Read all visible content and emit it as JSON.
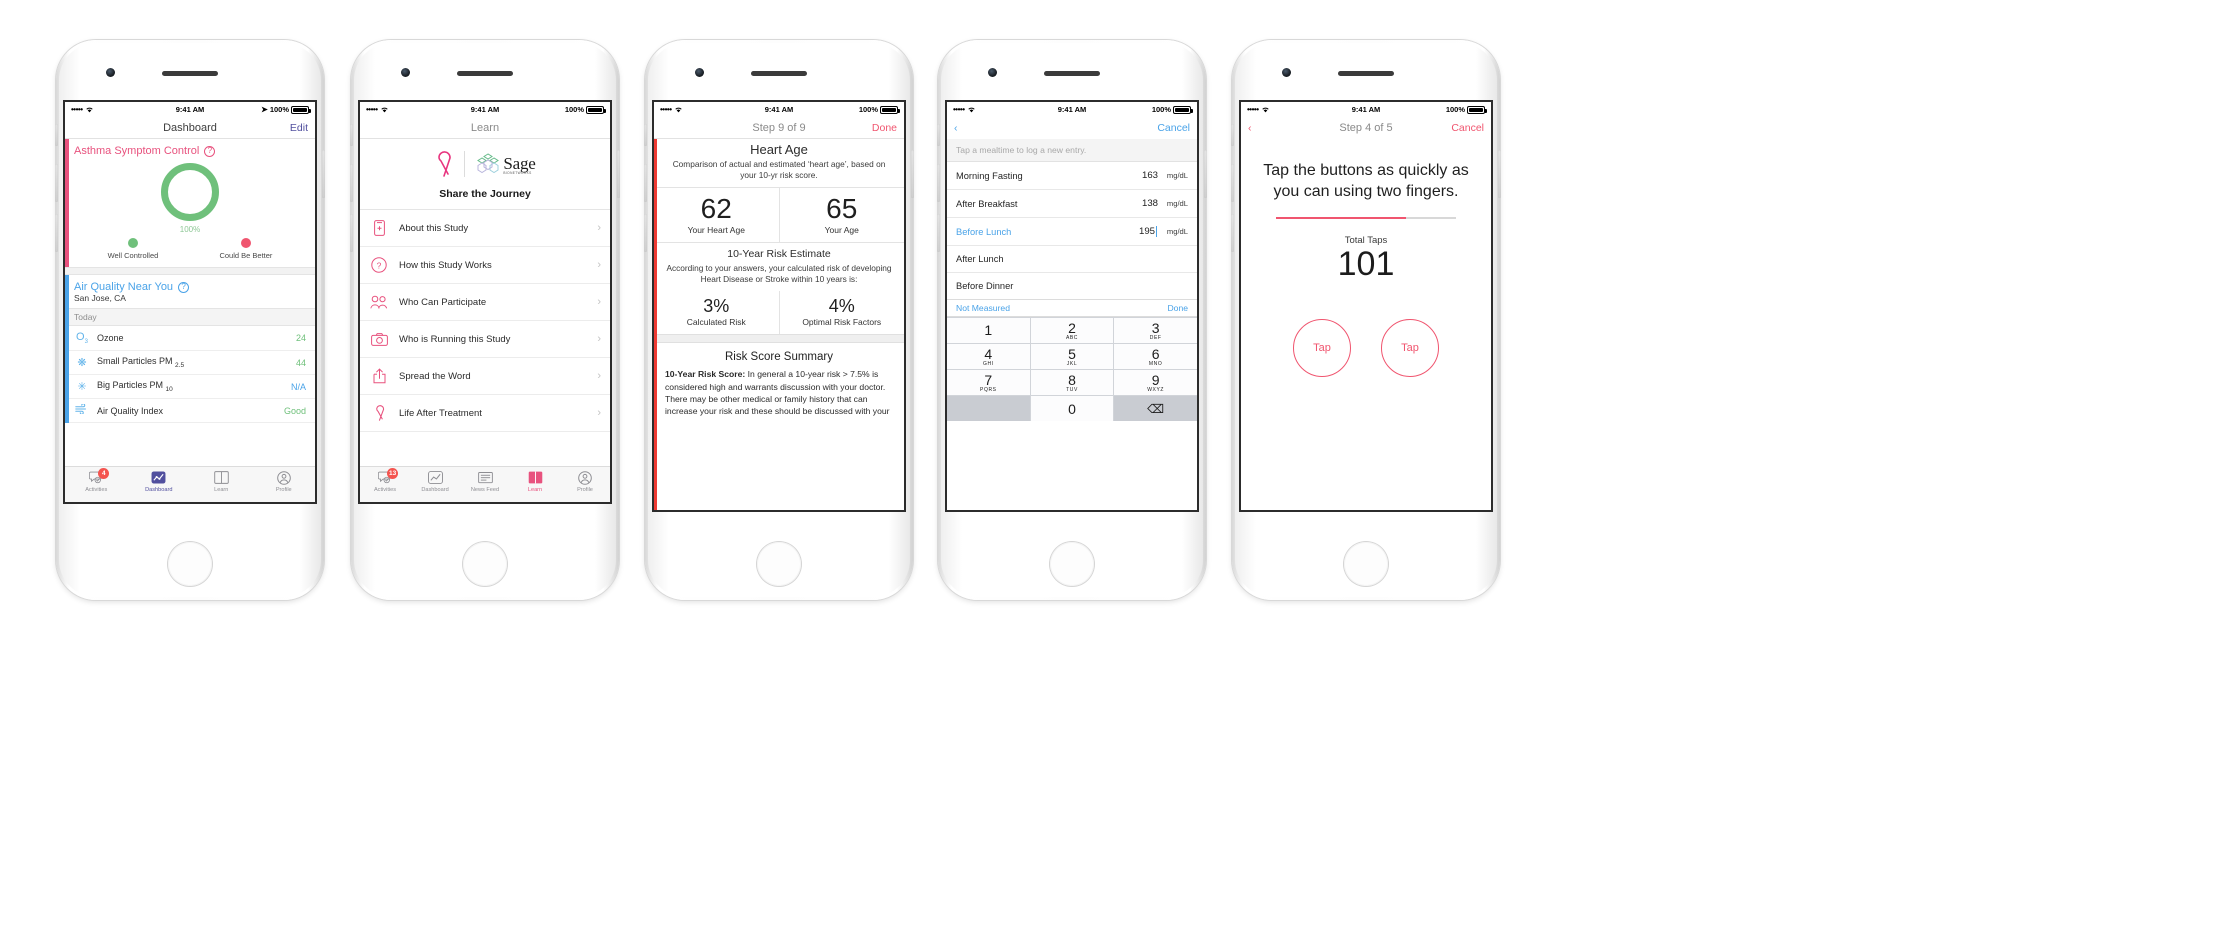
{
  "status_bar": {
    "signal": "•••••",
    "wifi": "wifi-icon",
    "time": "9:41 AM",
    "battery_pct": "100%"
  },
  "phone1": {
    "nav": {
      "title": "Dashboard",
      "right": "Edit"
    },
    "status_location_icon": "location-arrow-icon",
    "asthma": {
      "title": "Asthma Symptom Control",
      "help": "?",
      "ring_pct": "100%",
      "accent": "#e8527e",
      "ring_color": "#6fc07b",
      "legend": [
        {
          "label": "Well Controlled",
          "color": "#6fc07b"
        },
        {
          "label": "Could Be Better",
          "color": "#f0556f"
        }
      ]
    },
    "air": {
      "title": "Air Quality Near You",
      "help": "?",
      "location": "San Jose, CA",
      "section": "Today",
      "accent": "#4aa3e8",
      "rows": [
        {
          "icon": "ozone-icon",
          "name": "Ozone",
          "sub": "3",
          "value": "24",
          "value_color": "#6fc07b"
        },
        {
          "icon": "small-particles-icon",
          "name": "Small Particles PM",
          "sub": "2.5",
          "value": "44",
          "value_color": "#6fc07b"
        },
        {
          "icon": "big-particles-icon",
          "name": "Big Particles PM",
          "sub": "10",
          "value": "N/A",
          "value_color": "#4aa3e8"
        },
        {
          "icon": "wind-icon",
          "name": "Air Quality Index",
          "sub": "",
          "value": "Good",
          "value_color": "#6fc07b"
        }
      ]
    },
    "tabs": [
      {
        "label": "Activities",
        "icon": "chat-check-icon",
        "badge": "4",
        "active": false
      },
      {
        "label": "Dashboard",
        "icon": "line-chart-icon",
        "badge": "",
        "active": true
      },
      {
        "label": "Learn",
        "icon": "book-icon",
        "badge": "",
        "active": false
      },
      {
        "label": "Profile",
        "icon": "person-icon",
        "badge": "",
        "active": false
      }
    ]
  },
  "phone2": {
    "nav": {
      "title": "Learn"
    },
    "brand": {
      "ribbon_icon": "ribbon-icon",
      "logo_name": "Sage",
      "logo_sub": "BIONETWORKS",
      "headline": "Share the Journey"
    },
    "rows": [
      {
        "icon": "phone-plus-icon",
        "label": "About this Study"
      },
      {
        "icon": "question-circle-icon",
        "label": "How this Study Works"
      },
      {
        "icon": "people-icon",
        "label": "Who Can Participate"
      },
      {
        "icon": "camera-icon",
        "label": "Who is Running this Study"
      },
      {
        "icon": "share-icon",
        "label": "Spread the Word"
      },
      {
        "icon": "ribbon-icon",
        "label": "Life After Treatment"
      }
    ],
    "tabs": [
      {
        "label": "Activities",
        "icon": "chat-check-icon",
        "badge": "13",
        "active": false
      },
      {
        "label": "Dashboard",
        "icon": "line-chart-icon",
        "badge": "",
        "active": false
      },
      {
        "label": "News Feed",
        "icon": "news-icon",
        "badge": "",
        "active": false
      },
      {
        "label": "Learn",
        "icon": "book-icon",
        "badge": "",
        "active": true
      },
      {
        "label": "Profile",
        "icon": "person-icon",
        "badge": "",
        "active": false
      }
    ]
  },
  "phone3": {
    "nav": {
      "title": "Step 9 of 9",
      "right": "Done"
    },
    "accent": "#ee3a33",
    "heart_age": {
      "title": "Heart Age",
      "subtitle": "Comparison of actual and estimated ‘heart age’, based on your 10-yr risk score.",
      "left_value": "62",
      "left_caption": "Your Heart Age",
      "right_value": "65",
      "right_caption": "Your Age"
    },
    "risk": {
      "title": "10-Year Risk Estimate",
      "subtitle": "According to your answers, your calculated risk of developing Heart Disease or Stroke within 10 years is:",
      "left_value": "3%",
      "left_caption": "Calculated Risk",
      "right_value": "4%",
      "right_caption": "Optimal Risk Factors"
    },
    "summary": {
      "title": "Risk Score Summary",
      "lead": "10-Year Risk Score:",
      "body": " In general a 10-year risk > 7.5% is considered high and warrants discussion with your doctor. There may be other medical or family history that can increase your risk and these should be discussed with your"
    }
  },
  "phone4": {
    "nav": {
      "back": "back-chevron-icon",
      "right": "Cancel"
    },
    "hint": "Tap a mealtime to log a new entry.",
    "rows": [
      {
        "name": "Morning Fasting",
        "value": "163",
        "unit": "mg/dL",
        "active": false
      },
      {
        "name": "After Breakfast",
        "value": "138",
        "unit": "mg/dL",
        "active": false
      },
      {
        "name": "Before Lunch",
        "value": "195",
        "unit": "mg/dL",
        "active": true
      },
      {
        "name": "After Lunch",
        "value": "",
        "unit": "",
        "active": false
      },
      {
        "name": "Before Dinner",
        "value": "",
        "unit": "",
        "active": false
      }
    ],
    "keyboard_bar": {
      "left": "Not Measured",
      "right": "Done"
    },
    "keys": [
      {
        "num": "1",
        "sub": ""
      },
      {
        "num": "2",
        "sub": "ABC"
      },
      {
        "num": "3",
        "sub": "DEF"
      },
      {
        "num": "4",
        "sub": "GHI"
      },
      {
        "num": "5",
        "sub": "JKL"
      },
      {
        "num": "6",
        "sub": "MNO"
      },
      {
        "num": "7",
        "sub": "PQRS"
      },
      {
        "num": "8",
        "sub": "TUV"
      },
      {
        "num": "9",
        "sub": "WXYZ"
      },
      {
        "num": "",
        "sub": ""
      },
      {
        "num": "0",
        "sub": ""
      },
      {
        "num": "⌫",
        "sub": ""
      }
    ]
  },
  "phone5": {
    "nav": {
      "back": "back-chevron-icon",
      "title": "Step 4 of 5",
      "right": "Cancel"
    },
    "instruction": "Tap the buttons as quickly as you can using two fingers.",
    "progress_pct": 72,
    "total_caption": "Total Taps",
    "total_value": "101",
    "buttons": [
      {
        "label": "Tap"
      },
      {
        "label": "Tap"
      }
    ]
  }
}
